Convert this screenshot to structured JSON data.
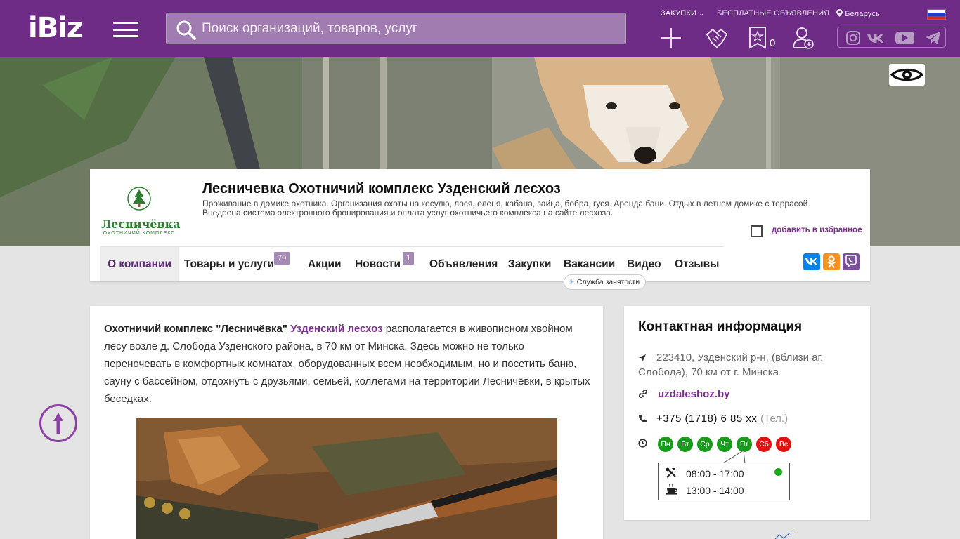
{
  "header": {
    "logo": "iBiz",
    "search_placeholder": "Поиск организаций, товаров, услуг",
    "links": {
      "purchases": "ЗАКУПКИ",
      "free_ads": "БЕСПЛАТНЫЕ ОБЪЯВЛЕНИЯ",
      "region": "Беларусь"
    },
    "favorites_count": "0",
    "colors": {
      "topbar": "#6f2c86",
      "accent": "#7e2f92"
    }
  },
  "company": {
    "logo_name": "Лесничёвка",
    "logo_sub": "ОХОТНИЧИЙ КОМПЛЕКС",
    "title": "Лесничевка Охотничий комплекс Узденский лесхоз",
    "description": "Проживание в домике охотника. Организация охоты на косулю, лося, оленя, кабана, зайца, бобра, гуся. Аренда бани. Отдых в летнем домике с террасой. Внедрена система электронного бронирования и оплата услуг охотничьего комплекса на сайте лесхоза.",
    "add_favorite": "добавить в избранное"
  },
  "tabs": [
    {
      "label": "О компании"
    },
    {
      "label": "Товары и услуги",
      "badge": "79"
    },
    {
      "label": "Акции"
    },
    {
      "label": "Новости",
      "badge": "1"
    },
    {
      "label": "Объявления"
    },
    {
      "label": "Закупки"
    },
    {
      "label": "Вакансии"
    },
    {
      "label": "Видео"
    },
    {
      "label": "Отзывы"
    }
  ],
  "employment_badge": "Служба занятости",
  "article": {
    "p_bold": "Охотничий комплекс \"Лесничёвка\"",
    "p_link": "Узденский лесхоз",
    "p_rest": "располагается в живописном хвойном лесу возле д. Слобода Узденского района, в 70 км от Минска. Здесь можно не только переночевать в комфортных комнатах, оборудованных всем необходимым, но и посетить баню, сауну с бассейном, отдохнуть с друзьями, семьей, коллегами на территории Лесничёвки, в крытых беседках."
  },
  "contact": {
    "title": "Контактная информация",
    "address": "223410, Узденский р-н, (вблизи аг. Слобода), 70 км от г. Минска",
    "site": "uzdaleshoz.by",
    "phone": "+375 (1718) 6 85 xx",
    "phone_type": "(Тел.)",
    "days": [
      {
        "label": "Пн",
        "color": "#1a9a1a"
      },
      {
        "label": "Вт",
        "color": "#1a9a1a"
      },
      {
        "label": "Ср",
        "color": "#1a9a1a"
      },
      {
        "label": "Чт",
        "color": "#1a9a1a"
      },
      {
        "label": "Пт",
        "color": "#1a9a1a"
      },
      {
        "label": "Сб",
        "color": "#e01212"
      },
      {
        "label": "Вс",
        "color": "#e01212"
      }
    ],
    "work_hours": "08:00 - 17:00",
    "break_hours": "13:00 - 14:00"
  }
}
